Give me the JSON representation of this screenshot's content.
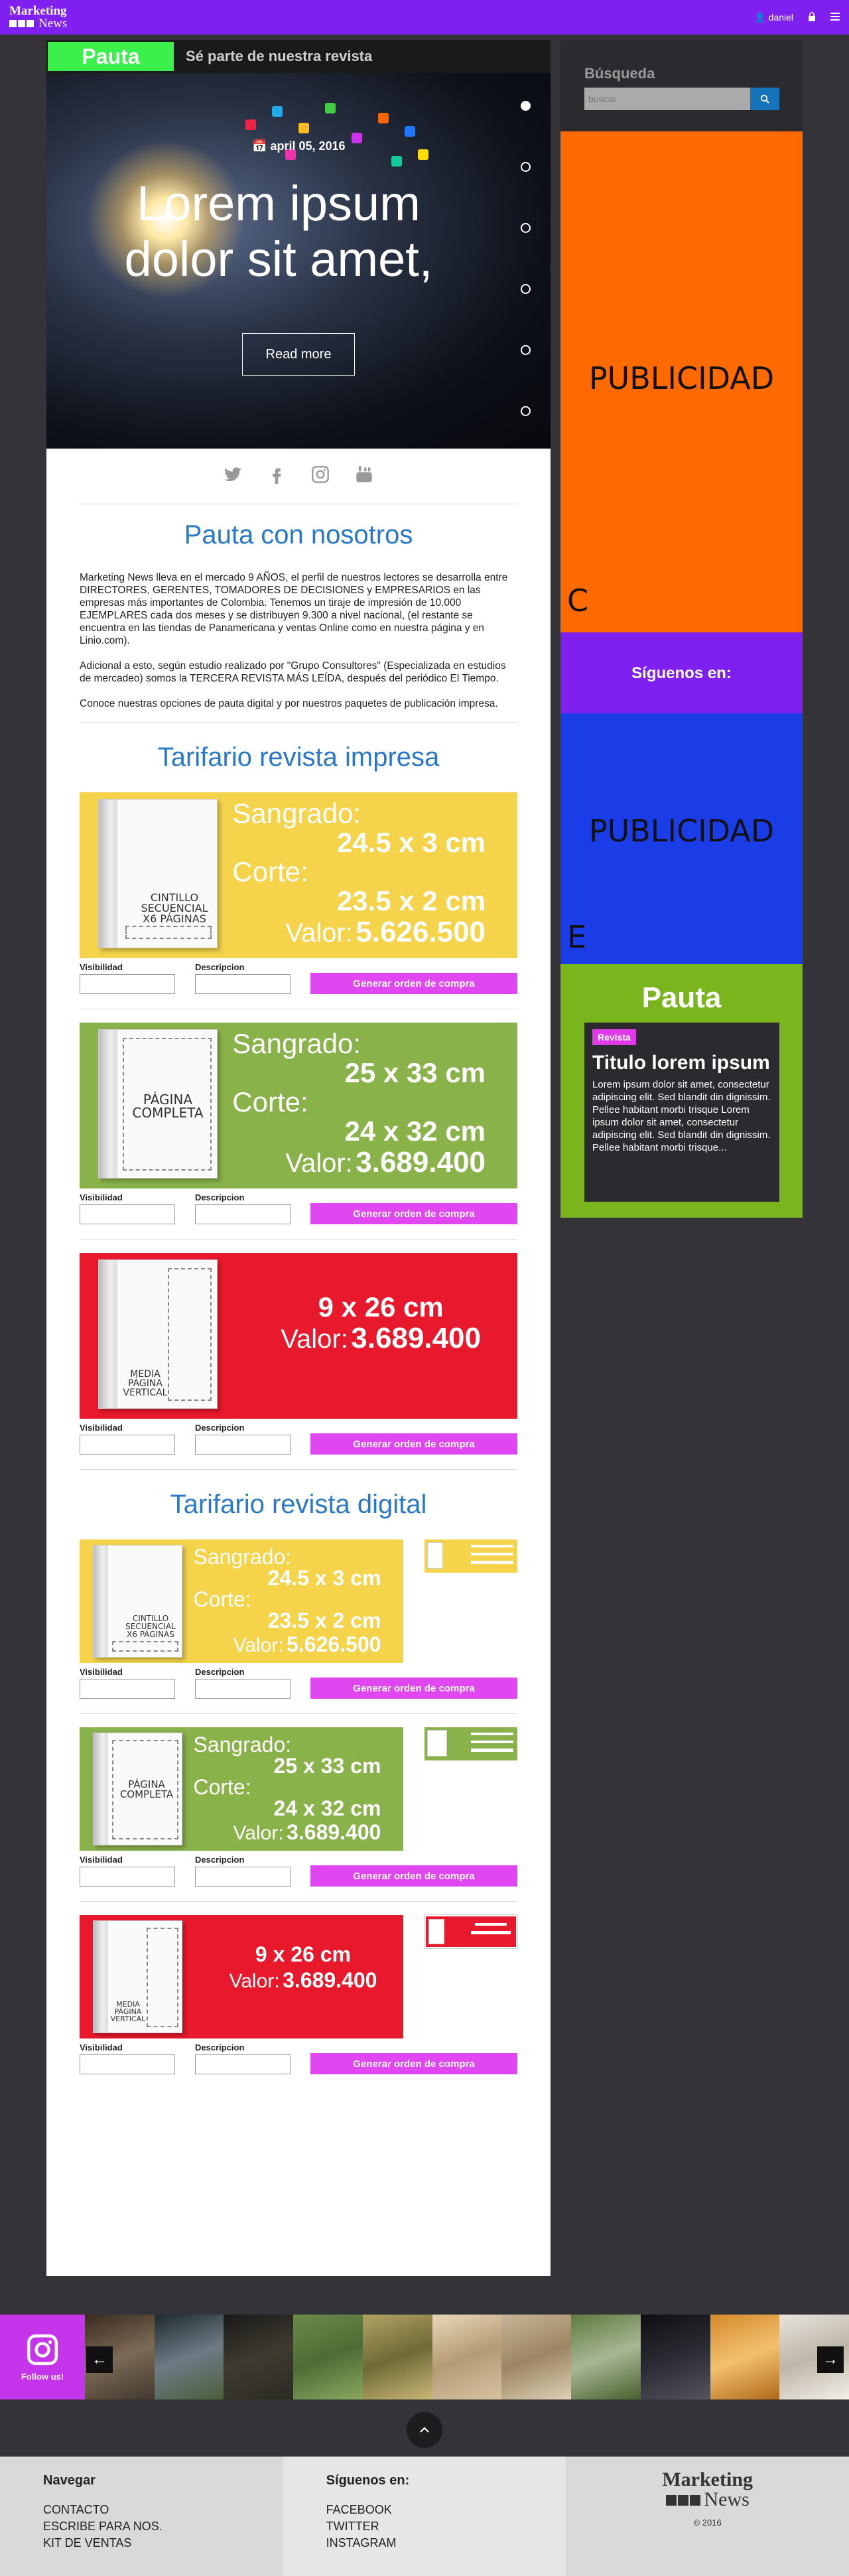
{
  "topbar": {
    "logo_top": "Marketing",
    "logo_bottom": "News",
    "user_label": "daniel",
    "lock_icon": "lock-icon",
    "menu_icon": "menu-icon",
    "bg_color": "#7f1ff0"
  },
  "slider": {
    "tab_label": "Pauta",
    "tab_subtitle": "Sé parte de nuestra revista",
    "date": "april 05, 2016",
    "title_line1": "Lorem ipsum",
    "title_line2": "dolor sit amet,",
    "read_more": "Read more",
    "dots": [
      true,
      false,
      false,
      false,
      false,
      false
    ]
  },
  "social_icons": [
    "twitter-icon",
    "facebook-icon",
    "instagram-icon",
    "youtube-icon"
  ],
  "intro": {
    "heading": "Pauta con nosotros",
    "p1": "Marketing News lleva en el mercado 9 AÑOS, el perfil de nuestros lectores se desarrolla entre DIRECTORES, GERENTES, TOMADORES DE DECISIONES y EMPRESARIOS en las empresas más importantes de Colombia. Tenemos un tiraje de impresión de 10.000 EJEMPLARES cada dos meses y se distribuyen 9.300 a nivel nacional, (el restante se encuentra en las tiendas de Panamericana y ventas Online como en nuestra página y en Linio.com).",
    "p2": "Adicional a esto, según estudio realizado por \"Grupo Consultores\" (Especializada en estudios de mercadeo) somos la TERCERA REVISTA MÁS LEÍDA, después del periódico El Tiempo.",
    "p3": "Conoce nuestras opciones de pauta digital y por nuestros paquetes de publicación impresa."
  },
  "form_labels": {
    "visibilidad": "Visibilidad",
    "descripcion": "Descripcion",
    "button": "Generar orden de compra"
  },
  "impresa": {
    "heading": "Tarifario revista impresa",
    "cards": [
      {
        "color": "#f5d34b",
        "label_lines": [
          "CINTILLO",
          "SECUENCIAL",
          "X6 PÁGINAS"
        ],
        "sangrado_label": "Sangrado:",
        "sangrado": "24.5 x 3 cm",
        "corte_label": "Corte:",
        "corte": "23.5 x 2 cm",
        "valor_label": "Valor:",
        "valor": "5.626.500"
      },
      {
        "color": "#8ab24a",
        "label_lines": [
          "PÁGINA",
          "COMPLETA"
        ],
        "sangrado_label": "Sangrado:",
        "sangrado": "25 x 33 cm",
        "corte_label": "Corte:",
        "corte": "24 x 32 cm",
        "valor_label": "Valor:",
        "valor": "3.689.400"
      },
      {
        "color": "#e8192c",
        "label_lines": [
          "MEDIA",
          "PÁGINA",
          "VERTICAL"
        ],
        "size": "9 x 26 cm",
        "valor_label": "Valor:",
        "valor": "3.689.400"
      }
    ]
  },
  "digital": {
    "heading": "Tarifario revista digital"
  },
  "sidebar": {
    "search_title": "Búsqueda",
    "search_placeholder": "buscar",
    "publicidad1": "PUBLICIDAD",
    "publicidad1_letter": "C",
    "publicidad1_color": "#ff6a00",
    "siguenos": "Síguenos en:",
    "siguenos_color": "#7f1ff0",
    "publicidad2": "PUBLICIDAD",
    "publicidad2_letter": "E",
    "publicidad2_color": "#1a3de8",
    "pauta_title": "Pauta",
    "pauta_color": "#7ab51d",
    "revista_badge": "Revista",
    "article_title": "Titulo lorem ipsum",
    "article_text": "Lorem ipsum dolor sit amet, consectetur adipiscing elit. Sed blandit din dignissim. Pellee habitant morbi trisque Lorem ipsum dolor sit amet, consectetur adipiscing elit. Sed blandit din dignissim. Pellee habitant morbi trisque..."
  },
  "instagram_strip": {
    "follow": "Follow us!"
  },
  "footer": {
    "nav_title": "Navegar",
    "nav_items": [
      "CONTACTO",
      "ESCRIBE PARA NOS.",
      "KIT DE VENTAS"
    ],
    "follow_title": "Síguenos en:",
    "follow_items": [
      "FACEBOOK",
      "TWITTER",
      "INSTAGRAM"
    ],
    "logo_top": "Marketing",
    "logo_bottom": "News",
    "copyright": "© 2016"
  }
}
